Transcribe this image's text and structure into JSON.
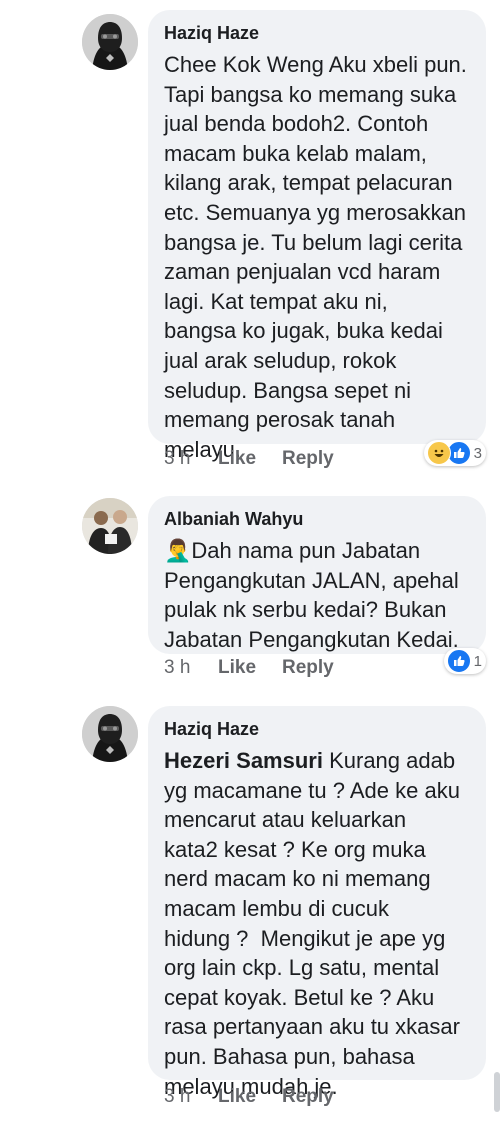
{
  "comments": [
    {
      "author": "Haziq Haze",
      "text": "Chee Kok Weng Aku xbeli pun.\nTapi bangsa ko memang suka\njual benda bodoh2. Contoh\nmacam buka kelab malam,\nkilang arak, tempat pelacuran\netc. Semuanya yg merosakkan\nbangsa je. Tu belum lagi cerita\nzaman penjualan vcd haram\nlagi. Kat tempat aku ni,\nbangsa ko jugak, buka kedai\njual arak seludup, rokok\nseludup. Bangsa sepet ni\nmemang perosak tanah\nmelayu.",
      "time": "3 h",
      "like_label": "Like",
      "reply_label": "Reply",
      "reaction_count": "3",
      "reaction_icons": [
        "haha-icon",
        "like-icon"
      ]
    },
    {
      "author": "Albaniah Wahyu",
      "emoji": "🤦‍♂️",
      "text": "Dah nama pun Jabatan\nPengangkutan JALAN, apehal\npulak nk serbu kedai? Bukan\nJabatan Pengangkutan Kedai.",
      "time": "3 h",
      "like_label": "Like",
      "reply_label": "Reply",
      "reaction_count": "1",
      "reaction_icons": [
        "like-icon"
      ]
    },
    {
      "author": "Haziq Haze",
      "mention": "Hezeri Samsuri",
      "text": " Kurang adab\nyg macamane tu ? Ade ke aku\nmencarut atau keluarkan\nkata2 kesat ? Ke org muka\nnerd macam ko ni memang\nmacam lembu di cucuk\nhidung ?  Mengikut je ape yg\norg lain ckp. Lg satu, mental\ncepat koyak. Betul ke ? Aku\nrasa pertanyaan aku tu xkasar\npun. Bahasa pun, bahasa\nmelayu mudah je.",
      "time": "3 h",
      "like_label": "Like",
      "reply_label": "Reply"
    }
  ],
  "colors": {
    "bubble": "#f0f2f5",
    "text": "#1c1e21",
    "meta": "#65676b",
    "like_blue": "#1877f2",
    "haha_yellow": "#f7c74a"
  }
}
